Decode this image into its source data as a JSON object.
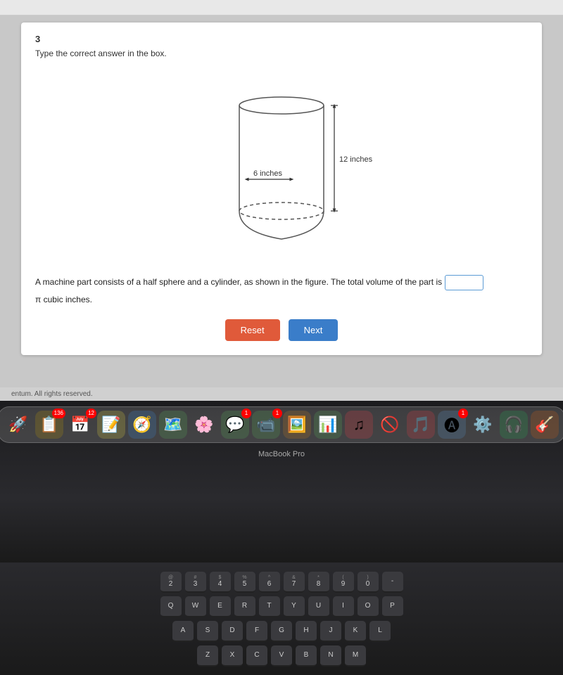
{
  "menubar": {
    "title": ""
  },
  "card": {
    "question_number": "3",
    "instruction": "Type the correct answer in the box.",
    "problem_text_before": "A machine part consists of a half sphere and a cylinder, as shown in the figure. The total volume of the part is",
    "problem_text_after": "π cubic inches.",
    "diagram": {
      "width_label": "6 inches",
      "height_label": "12 inches"
    },
    "answer_placeholder": "",
    "reset_button": "Reset",
    "next_button": "Next"
  },
  "footer": {
    "text": "entum. All rights reserved."
  },
  "dock": {
    "icons": [
      {
        "name": "Launchpad",
        "emoji": "🚀",
        "color": "#888",
        "badge": ""
      },
      {
        "name": "Notefile",
        "emoji": "📋",
        "color": "#c8a000",
        "badge": "136"
      },
      {
        "name": "Calendar",
        "emoji": "📅",
        "color": "#fff",
        "badge": "12"
      },
      {
        "name": "Notes",
        "emoji": "📝",
        "color": "#f5e642",
        "badge": ""
      },
      {
        "name": "Safari",
        "emoji": "🧭",
        "color": "#3a8fe8",
        "badge": ""
      },
      {
        "name": "Maps",
        "emoji": "🗺️",
        "color": "#5cb85c",
        "badge": ""
      },
      {
        "name": "Photos",
        "emoji": "🌸",
        "color": "#e8a",
        "badge": ""
      },
      {
        "name": "Messages",
        "emoji": "💬",
        "color": "#5cb85c",
        "badge": "1"
      },
      {
        "name": "Facetime",
        "emoji": "📹",
        "color": "#5cb85c",
        "badge": "1"
      },
      {
        "name": "Preview",
        "emoji": "🖼️",
        "color": "#d08020",
        "badge": ""
      },
      {
        "name": "Numbers",
        "emoji": "📊",
        "color": "#5cb85c",
        "badge": ""
      },
      {
        "name": "Music",
        "emoji": "♫",
        "color": "#fc3c44",
        "badge": ""
      },
      {
        "name": "Blocker",
        "emoji": "🚫",
        "color": "#e00",
        "badge": ""
      },
      {
        "name": "iTunes",
        "emoji": "🎵",
        "color": "#fc3c44",
        "badge": ""
      },
      {
        "name": "AppStore",
        "emoji": "🅐",
        "color": "#5b9bd5",
        "badge": "1"
      },
      {
        "name": "SystemPrefs",
        "emoji": "⚙️",
        "color": "#888",
        "badge": ""
      },
      {
        "name": "Spotify",
        "emoji": "🎧",
        "color": "#1db954",
        "badge": ""
      },
      {
        "name": "GarageBand",
        "emoji": "🎸",
        "color": "#e8630a",
        "badge": ""
      }
    ]
  },
  "keyboard": {
    "row1": [
      "@\n2",
      "#\n3",
      "$\n4",
      "%\n5",
      "^\n6",
      "&\n7",
      "*\n8",
      "(\n9",
      ")\n0",
      "-"
    ],
    "row2": [
      "Q",
      "W",
      "E",
      "R",
      "T",
      "Y",
      "U",
      "I",
      "O",
      "P"
    ],
    "row3": [
      "A",
      "S",
      "D",
      "F",
      "G",
      "H",
      "J",
      "K",
      "L"
    ],
    "row4": [
      "Z",
      "X",
      "C",
      "V",
      "B",
      "N",
      "M"
    ]
  },
  "macbook_label": "MacBook Pro"
}
